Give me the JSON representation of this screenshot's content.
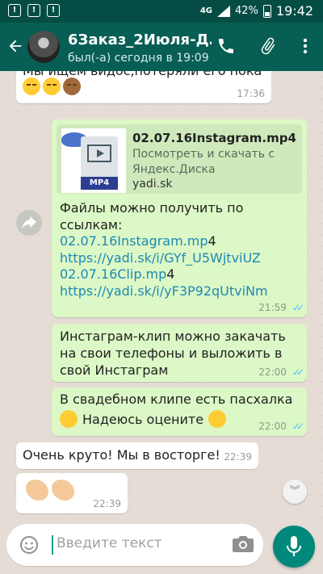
{
  "status_bar": {
    "network": "4G",
    "battery": "42%",
    "time": "19:42"
  },
  "header": {
    "title": "6Заказ_2Июля-Д…",
    "subtitle": "был(-а) сегодня в 19:09"
  },
  "messages": [
    {
      "type": "in",
      "text": "Мы ищем видос,потеряли его пока",
      "emojis": [
        "weary-face",
        "weary-face",
        "see-no-evil-monkey"
      ],
      "time": "17:36"
    },
    {
      "type": "out",
      "link_card": {
        "title": "02.07.16Instagram.mp4",
        "description": "Посмотреть и скачать с Яндекс.Диска",
        "domain": "yadi.sk",
        "badge": "MP4"
      },
      "body_intro": "Файлы можно получить по ссылкам:",
      "lines": [
        {
          "link": "02.07.16Instagram.mp",
          "suffix": "4"
        },
        {
          "link": "https://yadi.sk/i/GYf_U5WjtviUZ",
          "suffix": ""
        },
        {
          "link": "02.07.16Clip.mp",
          "suffix": "4"
        },
        {
          "link": "https://yadi.sk/i/yF3P92qUtviNm",
          "suffix": ""
        }
      ],
      "time": "21:59",
      "status": "read"
    },
    {
      "type": "out",
      "text": "Инстаграм-клип можно закачать на свои телефоны и выложить в свой Инстаграм",
      "time": "22:00",
      "status": "read"
    },
    {
      "type": "out",
      "line1": "В свадебном клипе есть пасхалка",
      "line2": "Надеюсь оцените",
      "emojis": [
        "face-savoring-food",
        "face-with-tears-of-joy"
      ],
      "time": "22:00",
      "status": "read"
    },
    {
      "type": "in",
      "text": "Очень круто! Мы в восторге!",
      "time": "22:39"
    },
    {
      "type": "in",
      "emojis": [
        "clapping-hands",
        "clapping-hands"
      ],
      "time": "22:39"
    }
  ],
  "input": {
    "placeholder": "Введите текст"
  },
  "colors": {
    "header": "#075e54",
    "status_bar": "#054d44",
    "outgoing": "#dcf8c6",
    "incoming": "#ffffff",
    "accent": "#00897b",
    "read_ticks": "#4fc3f7"
  }
}
